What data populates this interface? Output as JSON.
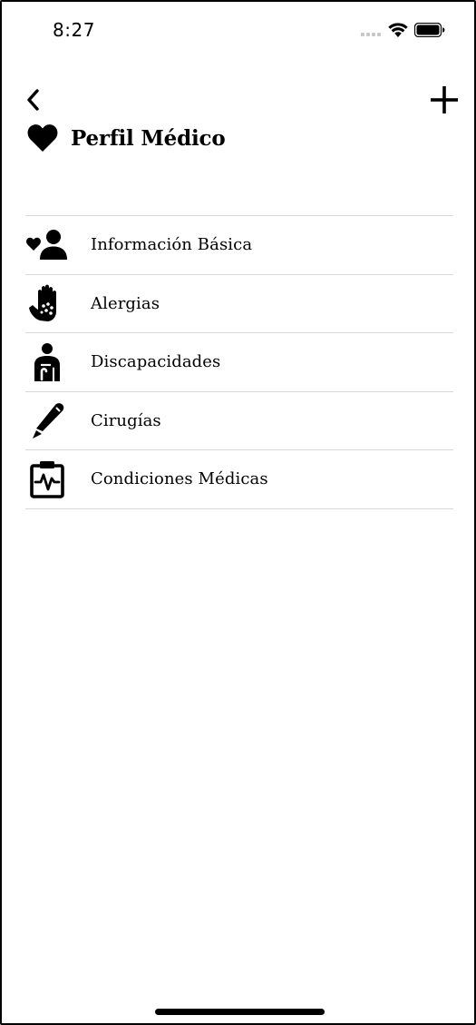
{
  "status_bar": {
    "time": "8:27",
    "icons": [
      "cellular-dots-icon",
      "wifi-icon",
      "battery-icon"
    ]
  },
  "header": {
    "back_icon": "chevron-left-icon",
    "add_icon": "plus-icon",
    "title_icon": "heart-icon",
    "title": "Perfil Médico"
  },
  "menu": {
    "items": [
      {
        "label": "Información Básica",
        "icon": "heart-person-icon"
      },
      {
        "label": "Alergias",
        "icon": "hand-dots-icon"
      },
      {
        "label": "Discapacidades",
        "icon": "person-cane-icon"
      },
      {
        "label": "Cirugías",
        "icon": "scalpel-icon"
      },
      {
        "label": "Condiciones Médicas",
        "icon": "clipboard-pulse-icon"
      }
    ]
  },
  "colors": {
    "background": "#ffffff",
    "text": "#000000",
    "divider": "#d8d8d8"
  }
}
